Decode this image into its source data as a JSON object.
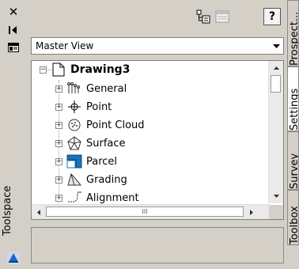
{
  "palette": {
    "title": "Toolspace",
    "close_glyph": "✕"
  },
  "toolbar": {
    "help_label": "?"
  },
  "view_selector": {
    "selected": "Master View"
  },
  "tree": {
    "root": {
      "label": "Drawing3",
      "expander": "−"
    },
    "items": [
      {
        "label": "General",
        "icon": "general-collection-icon",
        "expander": "+"
      },
      {
        "label": "Point",
        "icon": "point-icon",
        "expander": "+"
      },
      {
        "label": "Point Cloud",
        "icon": "point-cloud-icon",
        "expander": "+"
      },
      {
        "label": "Surface",
        "icon": "surface-icon",
        "expander": "+"
      },
      {
        "label": "Parcel",
        "icon": "parcel-icon",
        "expander": "+"
      },
      {
        "label": "Grading",
        "icon": "grading-icon",
        "expander": "+"
      },
      {
        "label": "Alignment",
        "icon": "alignment-icon",
        "expander": "+"
      }
    ]
  },
  "hscroll": {
    "grip": "III"
  },
  "tabs": [
    {
      "label": "Prospect...",
      "active": false
    },
    {
      "label": "Settings",
      "active": true
    },
    {
      "label": "Survey",
      "active": false
    },
    {
      "label": "Toolbox",
      "active": false
    }
  ],
  "colors": {
    "panel_bg": "#d4d0c8",
    "tree_bg": "#ffffff",
    "parcel_icon": "#1a73b8",
    "palette_icon": "#1e63c8"
  }
}
